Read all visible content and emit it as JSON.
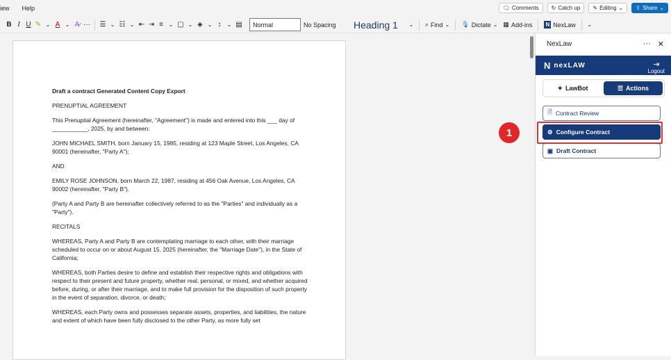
{
  "menu": {
    "items": [
      "iew",
      "Help"
    ]
  },
  "top_actions": {
    "comments": "Comments",
    "catch_up": "Catch up",
    "editing": "Editing",
    "share": "Share"
  },
  "ribbon": {
    "bold": "B",
    "italic": "I",
    "underline": "U",
    "font_color": "A",
    "more": "···",
    "styles": {
      "normal": "Normal",
      "no_spacing": "No Spacing",
      "heading1": "Heading 1"
    },
    "find": "Find",
    "dictate": "Dictate",
    "addins": "Add-ins",
    "nexlaw": "NexLaw"
  },
  "document": {
    "paragraphs": [
      "Draft a contract Generated Content Copy Export",
      "PRENUPTIAL AGREEMENT",
      "This Prenuptial Agreement (hereinafter, \"Agreement\") is made and entered into this ___ day of ___________, 2025, by and between:",
      "JOHN MICHAEL SMITH, born January 15, 1985, residing at 123 Maple Street, Los Angeles, CA 90001 (hereinafter, \"Party A\");",
      "AND",
      "EMILY ROSE JOHNSON, born March 22, 1987, residing at 456 Oak Avenue, Los Angeles, CA 90002 (hereinafter, \"Party B\").",
      "(Party A and Party B are hereinafter collectively referred to as the \"Parties\" and individually as a \"Party\").",
      "RECITALS",
      "WHEREAS, Party A and Party B are contemplating marriage to each other, with their marriage scheduled to occur on or about August 15, 2025 (hereinafter, the \"Marriage Date\"), in the State of California;",
      "WHEREAS, both Parties desire to define and establish their respective rights and obligations with respect to their present and future property, whether real, personal, or mixed, and whether acquired before, during, or after their marriage, and to make full provision for the disposition of such property in the event of separation, divorce, or death;",
      "WHEREAS, each Party owns and possesses separate assets, properties, and liabilities, the nature and extent of which have been fully disclosed to the other Party, as more fully set"
    ]
  },
  "pane": {
    "title": "NexLaw",
    "brand": "nexLAW",
    "logout": "Logout",
    "tabs": {
      "lawbot": "LawBot",
      "actions": "Actions"
    },
    "actions": {
      "contract_review": "Contract Review",
      "configure_contract": "Configure Contract",
      "draft_contract": "Draft Contract"
    }
  },
  "annotation": {
    "step": "1"
  },
  "colors": {
    "brand": "#163a7a",
    "highlight": "#e03131",
    "share": "#0f6cbd"
  }
}
